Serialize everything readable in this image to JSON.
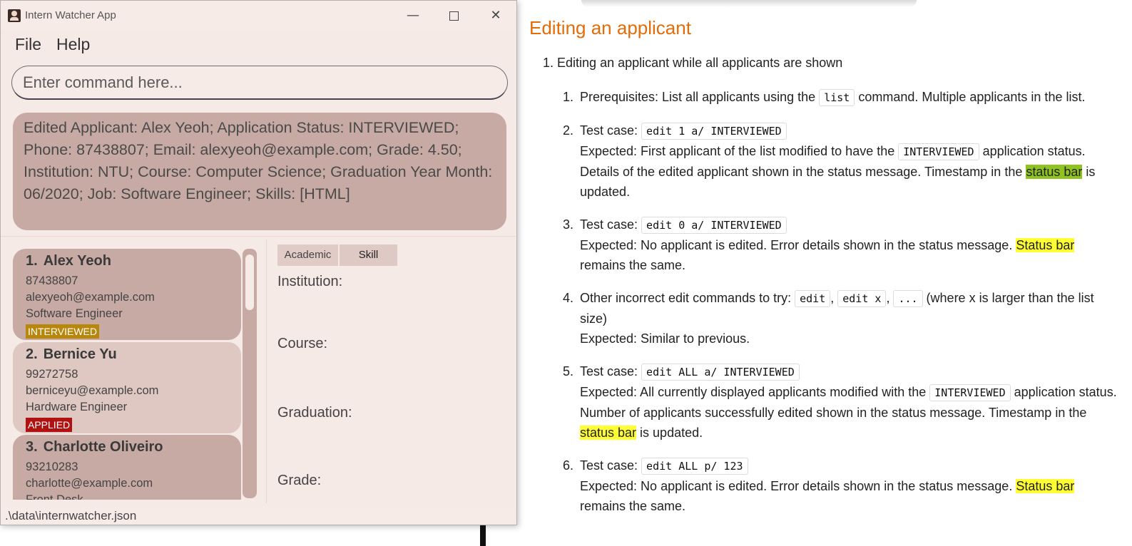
{
  "doc": {
    "heading": "Editing an applicant",
    "outer_num": "1.",
    "outer_text": "Editing an applicant while all applicants are shown",
    "items": [
      {
        "n": "1.",
        "pre": "Prerequisites: List all applicants using the ",
        "code": "list",
        "post": " command. Multiple applicants in the list."
      },
      {
        "n": "2.",
        "label": "Test case: ",
        "code": "edit 1 a/ INTERVIEWED",
        "exp_pre": "Expected: First applicant of the list modified to have the ",
        "exp_code": "INTERVIEWED",
        "exp_mid": " application status. Details of the edited applicant shown in the status message. Timestamp in the ",
        "exp_hl": "status bar",
        "exp_post": " is updated."
      },
      {
        "n": "3.",
        "label": "Test case: ",
        "code": "edit 0 a/ INTERVIEWED",
        "exp_pre": "Expected: No applicant is edited. Error details shown in the status message. ",
        "exp_hl": "Status bar",
        "exp_post": " remains the same."
      },
      {
        "n": "4.",
        "pre": "Other incorrect edit commands to try: ",
        "codes": [
          "edit",
          "edit x",
          "..."
        ],
        "post": " (where x is larger than the list size)",
        "expected": "Expected: Similar to previous."
      },
      {
        "n": "5.",
        "label": "Test case: ",
        "code": "edit ALL a/ INTERVIEWED",
        "exp_pre": "Expected: All currently displayed applicants modified with the ",
        "exp_code": "INTERVIEWED",
        "exp_mid": " application status. Number of applicants successfully edited shown in the status message. Timestamp in the ",
        "exp_hl": "status bar",
        "exp_post": " is updated."
      },
      {
        "n": "6.",
        "label": "Test case: ",
        "code": "edit ALL p/ 123",
        "exp_pre": "Expected: No applicant is edited. Error details shown in the status message. ",
        "exp_hl": "Status bar",
        "exp_post": " remains the same."
      }
    ]
  },
  "window": {
    "title": "Intern Watcher App",
    "minimize": "—",
    "close": "✕"
  },
  "menu": {
    "file": "File",
    "help": "Help"
  },
  "command": {
    "placeholder": "Enter command here..."
  },
  "result_text": "Edited Applicant: Alex Yeoh; Application Status: INTERVIEWED; Phone: 87438807; Email: alexyeoh@example.com; Grade: 4.50; Institution: NTU; Course: Computer Science; Graduation Year Month: 06/2020; Job: Software Engineer; Skills: [HTML]",
  "applicants": [
    {
      "index": "1.",
      "name": "Alex Yeoh",
      "phone": "87438807",
      "email": "alexyeoh@example.com",
      "job": "Software Engineer",
      "status": "INTERVIEWED"
    },
    {
      "index": "2.",
      "name": "Bernice Yu",
      "phone": "99272758",
      "email": "berniceyu@example.com",
      "job": "Hardware Engineer",
      "status": "APPLIED"
    },
    {
      "index": "3.",
      "name": "Charlotte Oliveiro",
      "phone": "93210283",
      "email": "charlotte@example.com",
      "job": "Front Desk"
    }
  ],
  "tabs": {
    "academic": "Academic",
    "skill": "Skill"
  },
  "details": {
    "institution": "Institution:",
    "course": "Course:",
    "graduation": "Graduation:",
    "grade": "Grade:"
  },
  "status_bar": ".\\data\\internwatcher.json",
  "colors": {
    "heading": "#e36c09",
    "highlight_green": "#8fc31f",
    "highlight_yellow": "#ffff33",
    "interviewed": "#b8860b",
    "applied": "#b01212"
  }
}
